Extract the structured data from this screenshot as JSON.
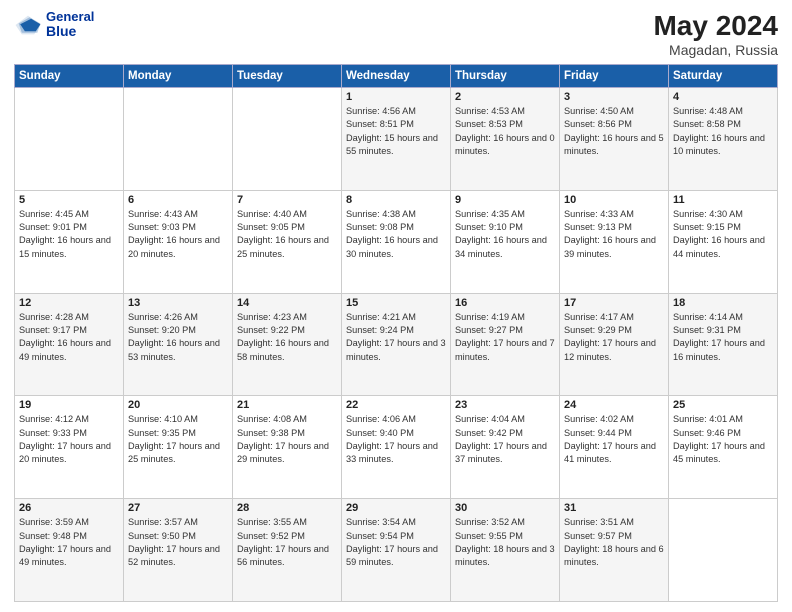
{
  "header": {
    "logo_line1": "General",
    "logo_line2": "Blue",
    "month_year": "May 2024",
    "location": "Magadan, Russia"
  },
  "weekdays": [
    "Sunday",
    "Monday",
    "Tuesday",
    "Wednesday",
    "Thursday",
    "Friday",
    "Saturday"
  ],
  "weeks": [
    [
      {
        "day": "",
        "text": ""
      },
      {
        "day": "",
        "text": ""
      },
      {
        "day": "",
        "text": ""
      },
      {
        "day": "1",
        "text": "Sunrise: 4:56 AM\nSunset: 8:51 PM\nDaylight: 15 hours\nand 55 minutes."
      },
      {
        "day": "2",
        "text": "Sunrise: 4:53 AM\nSunset: 8:53 PM\nDaylight: 16 hours\nand 0 minutes."
      },
      {
        "day": "3",
        "text": "Sunrise: 4:50 AM\nSunset: 8:56 PM\nDaylight: 16 hours\nand 5 minutes."
      },
      {
        "day": "4",
        "text": "Sunrise: 4:48 AM\nSunset: 8:58 PM\nDaylight: 16 hours\nand 10 minutes."
      }
    ],
    [
      {
        "day": "5",
        "text": "Sunrise: 4:45 AM\nSunset: 9:01 PM\nDaylight: 16 hours\nand 15 minutes."
      },
      {
        "day": "6",
        "text": "Sunrise: 4:43 AM\nSunset: 9:03 PM\nDaylight: 16 hours\nand 20 minutes."
      },
      {
        "day": "7",
        "text": "Sunrise: 4:40 AM\nSunset: 9:05 PM\nDaylight: 16 hours\nand 25 minutes."
      },
      {
        "day": "8",
        "text": "Sunrise: 4:38 AM\nSunset: 9:08 PM\nDaylight: 16 hours\nand 30 minutes."
      },
      {
        "day": "9",
        "text": "Sunrise: 4:35 AM\nSunset: 9:10 PM\nDaylight: 16 hours\nand 34 minutes."
      },
      {
        "day": "10",
        "text": "Sunrise: 4:33 AM\nSunset: 9:13 PM\nDaylight: 16 hours\nand 39 minutes."
      },
      {
        "day": "11",
        "text": "Sunrise: 4:30 AM\nSunset: 9:15 PM\nDaylight: 16 hours\nand 44 minutes."
      }
    ],
    [
      {
        "day": "12",
        "text": "Sunrise: 4:28 AM\nSunset: 9:17 PM\nDaylight: 16 hours\nand 49 minutes."
      },
      {
        "day": "13",
        "text": "Sunrise: 4:26 AM\nSunset: 9:20 PM\nDaylight: 16 hours\nand 53 minutes."
      },
      {
        "day": "14",
        "text": "Sunrise: 4:23 AM\nSunset: 9:22 PM\nDaylight: 16 hours\nand 58 minutes."
      },
      {
        "day": "15",
        "text": "Sunrise: 4:21 AM\nSunset: 9:24 PM\nDaylight: 17 hours\nand 3 minutes."
      },
      {
        "day": "16",
        "text": "Sunrise: 4:19 AM\nSunset: 9:27 PM\nDaylight: 17 hours\nand 7 minutes."
      },
      {
        "day": "17",
        "text": "Sunrise: 4:17 AM\nSunset: 9:29 PM\nDaylight: 17 hours\nand 12 minutes."
      },
      {
        "day": "18",
        "text": "Sunrise: 4:14 AM\nSunset: 9:31 PM\nDaylight: 17 hours\nand 16 minutes."
      }
    ],
    [
      {
        "day": "19",
        "text": "Sunrise: 4:12 AM\nSunset: 9:33 PM\nDaylight: 17 hours\nand 20 minutes."
      },
      {
        "day": "20",
        "text": "Sunrise: 4:10 AM\nSunset: 9:35 PM\nDaylight: 17 hours\nand 25 minutes."
      },
      {
        "day": "21",
        "text": "Sunrise: 4:08 AM\nSunset: 9:38 PM\nDaylight: 17 hours\nand 29 minutes."
      },
      {
        "day": "22",
        "text": "Sunrise: 4:06 AM\nSunset: 9:40 PM\nDaylight: 17 hours\nand 33 minutes."
      },
      {
        "day": "23",
        "text": "Sunrise: 4:04 AM\nSunset: 9:42 PM\nDaylight: 17 hours\nand 37 minutes."
      },
      {
        "day": "24",
        "text": "Sunrise: 4:02 AM\nSunset: 9:44 PM\nDaylight: 17 hours\nand 41 minutes."
      },
      {
        "day": "25",
        "text": "Sunrise: 4:01 AM\nSunset: 9:46 PM\nDaylight: 17 hours\nand 45 minutes."
      }
    ],
    [
      {
        "day": "26",
        "text": "Sunrise: 3:59 AM\nSunset: 9:48 PM\nDaylight: 17 hours\nand 49 minutes."
      },
      {
        "day": "27",
        "text": "Sunrise: 3:57 AM\nSunset: 9:50 PM\nDaylight: 17 hours\nand 52 minutes."
      },
      {
        "day": "28",
        "text": "Sunrise: 3:55 AM\nSunset: 9:52 PM\nDaylight: 17 hours\nand 56 minutes."
      },
      {
        "day": "29",
        "text": "Sunrise: 3:54 AM\nSunset: 9:54 PM\nDaylight: 17 hours\nand 59 minutes."
      },
      {
        "day": "30",
        "text": "Sunrise: 3:52 AM\nSunset: 9:55 PM\nDaylight: 18 hours\nand 3 minutes."
      },
      {
        "day": "31",
        "text": "Sunrise: 3:51 AM\nSunset: 9:57 PM\nDaylight: 18 hours\nand 6 minutes."
      },
      {
        "day": "",
        "text": ""
      }
    ]
  ]
}
